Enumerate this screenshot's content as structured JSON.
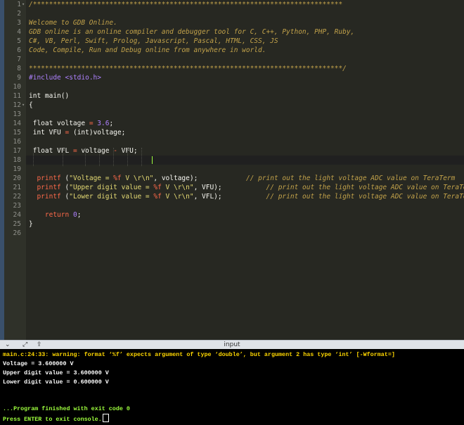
{
  "editor": {
    "lines": [
      {
        "n": "1",
        "fold": "▾",
        "html": "<span class='c'>/*****************************************************************************</span>"
      },
      {
        "n": "2",
        "fold": "",
        "html": ""
      },
      {
        "n": "3",
        "fold": "",
        "html": "<span class='c'>Welcome to GDB Online.</span>"
      },
      {
        "n": "4",
        "fold": "",
        "html": "<span class='c'>GDB online is an online compiler and debugger tool for C, C++, Python, PHP, Ruby,</span>"
      },
      {
        "n": "5",
        "fold": "",
        "html": "<span class='c'>C#, VB, Perl, Swift, Prolog, Javascript, Pascal, HTML, CSS, JS</span>"
      },
      {
        "n": "6",
        "fold": "",
        "html": "<span class='c'>Code, Compile, Run and Debug online from anywhere in world.</span>"
      },
      {
        "n": "7",
        "fold": "",
        "html": ""
      },
      {
        "n": "8",
        "fold": "",
        "html": "<span class='c'>******************************************************************************/</span>"
      },
      {
        "n": "9",
        "fold": "",
        "html": "<span class='p'>#include</span> <span class='p'>&lt;stdio.h&gt;</span>"
      },
      {
        "n": "10",
        "fold": "",
        "html": ""
      },
      {
        "n": "11",
        "fold": "",
        "html": "<span class='w'>int main()</span>"
      },
      {
        "n": "12",
        "fold": "▾",
        "html": "<span class='w'>{</span>"
      },
      {
        "n": "13",
        "fold": "",
        "html": ""
      },
      {
        "n": "14",
        "fold": "",
        "html": " <span class='w'>float voltage</span> <span class='o'>=</span> <span class='n'>3.6</span><span class='w'>;</span>"
      },
      {
        "n": "15",
        "fold": "",
        "html": " <span class='w'>int VFU</span> <span class='o'>=</span> <span class='w'>(int)voltage;</span>"
      },
      {
        "n": "16",
        "fold": "",
        "html": ""
      },
      {
        "n": "17",
        "fold": "",
        "html": " <span class='w'>float VFL</span> <span class='o'>=</span> <span class='w'>voltage</span> <span class='o'>-</span> <span class='w'>VFU;</span>"
      },
      {
        "n": "18",
        "fold": "",
        "html": ""
      },
      {
        "n": "19",
        "fold": "",
        "html": ""
      },
      {
        "n": "20",
        "fold": "",
        "html": "  <span class='o'>printf</span> <span class='w'>(</span><span class='s'>\"Voltage = <span class='o'>%f</span> V \\r\\n\"</span><span class='w'>, voltage);</span>            <span class='c'>// print out the light voltage ADC value on TeraTerm</span>"
      },
      {
        "n": "21",
        "fold": "",
        "html": "  <span class='o'>printf</span> <span class='w'>(</span><span class='s'>\"Upper digit value = <span class='o'>%f</span> V \\r\\n\"</span><span class='w'>, VFU);</span>           <span class='c'>// print out the light voltage ADC value on TeraTerm</span>"
      },
      {
        "n": "22",
        "fold": "",
        "html": "  <span class='o'>printf</span> <span class='w'>(</span><span class='s'>\"Lower digit value = <span class='o'>%f</span> V \\r\\n\"</span><span class='w'>, VFL);</span>           <span class='c'>// print out the light voltage ADC value on TeraTerm</span>"
      },
      {
        "n": "23",
        "fold": "",
        "html": ""
      },
      {
        "n": "24",
        "fold": "",
        "html": "    <span class='o'>return</span> <span class='n'>0</span><span class='w'>;</span>"
      },
      {
        "n": "25",
        "fold": "",
        "html": "<span class='w'>}</span>"
      },
      {
        "n": "26",
        "fold": "",
        "html": ""
      }
    ]
  },
  "panel": {
    "title": "input",
    "icons": [
      "chevron-down-icon",
      "expand-icon",
      "share-icon"
    ]
  },
  "console": {
    "lines": [
      {
        "text": "main.c:24:33: warning: format ‘%f’ expects argument of type ‘double’, but argument 2 has type ‘int’ [-Wformat=]",
        "color": "yellow"
      },
      {
        "text": "Voltage = 3.600000 V",
        "color": "white"
      },
      {
        "text": "Upper digit value = 3.600000 V",
        "color": "white"
      },
      {
        "text": "Lower digit value = 0.600000 V",
        "color": "white"
      },
      {
        "text": "",
        "color": "white"
      },
      {
        "text": "",
        "color": "white"
      },
      {
        "text": "...Program finished with exit code 0",
        "color": "green"
      },
      {
        "text": "Press ENTER to exit console.",
        "color": "green"
      }
    ]
  },
  "colors": {
    "editor_bg": "#272822",
    "console_bg": "#000000",
    "comment": "#c2a24a",
    "keyword_red": "#ff6a4a",
    "string": "#e6db74",
    "number": "#ae81ff"
  }
}
